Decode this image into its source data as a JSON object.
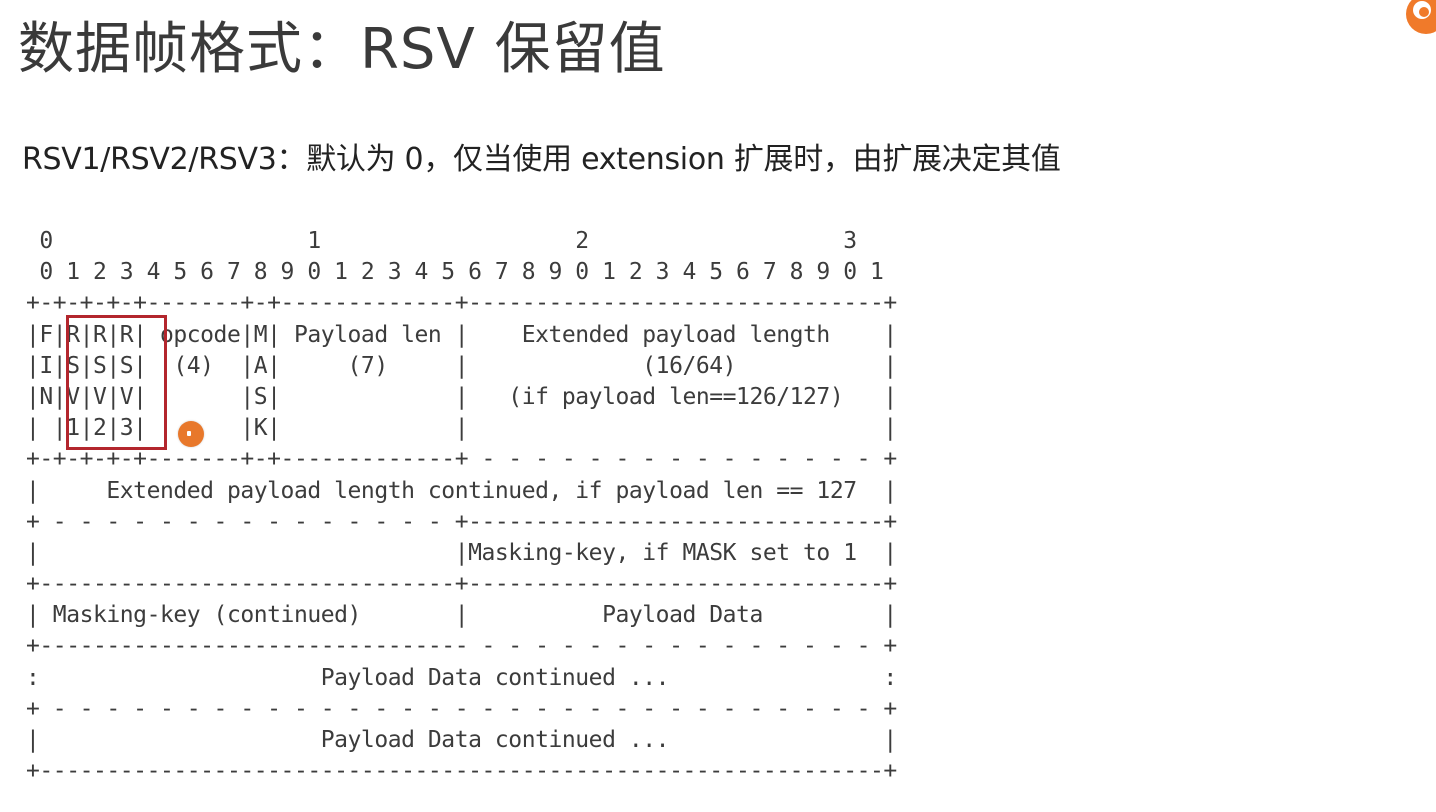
{
  "title": "数据帧格式：RSV 保留值",
  "subtitle": "RSV1/RSV2/RSV3：默认为 0，仅当使用 extension 扩展时，由扩展决定其值",
  "logo_icon": "flame-logo-icon",
  "highlight_color": "#b3262d",
  "pointer_color": "#e8782b",
  "diagram": {
    "lines": [
      " 0                   1                   2                   3",
      " 0 1 2 3 4 5 6 7 8 9 0 1 2 3 4 5 6 7 8 9 0 1 2 3 4 5 6 7 8 9 0 1",
      "+-+-+-+-+-------+-+-------------+-------------------------------+",
      "|F|R|R|R| opcode|M| Payload len |    Extended payload length    |",
      "|I|S|S|S|  (4)  |A|     (7)     |             (16/64)           |",
      "|N|V|V|V|       |S|             |   (if payload len==126/127)   |",
      "| |1|2|3|       |K|             |                               |",
      "+-+-+-+-+-------+-+-------------+ - - - - - - - - - - - - - - - +",
      "|     Extended payload length continued, if payload len == 127  |",
      "+ - - - - - - - - - - - - - - - +-------------------------------+",
      "|                               |Masking-key, if MASK set to 1  |",
      "+-------------------------------+-------------------------------+",
      "| Masking-key (continued)       |          Payload Data         |",
      "+-------------------------------- - - - - - - - - - - - - - - - +",
      ":                     Payload Data continued ...                :",
      "+ - - - - - - - - - - - - - - - - - - - - - - - - - - - - - - - +",
      "|                     Payload Data continued ...                |",
      "+---------------------------------------------------------------+"
    ]
  }
}
